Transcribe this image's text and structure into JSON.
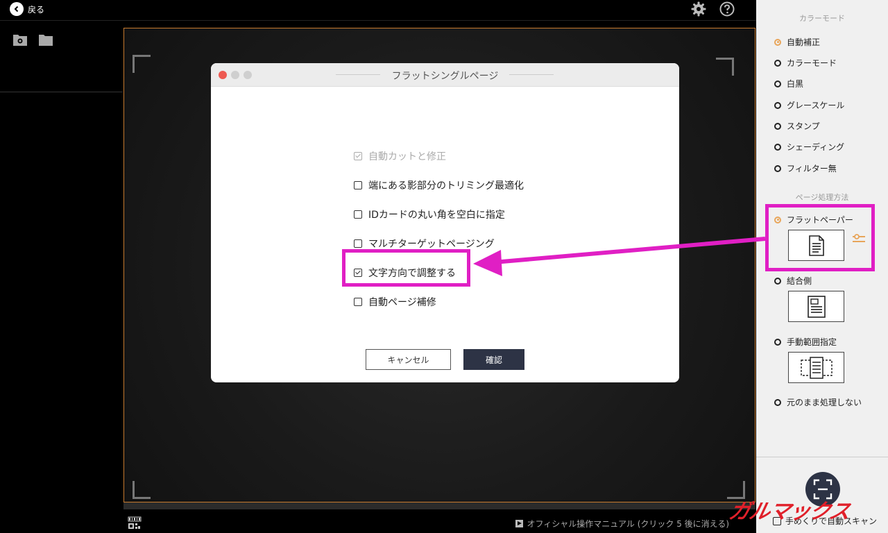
{
  "topbar": {
    "back_label": "戻る"
  },
  "dialog": {
    "title": "フラットシングルページ",
    "options": [
      {
        "label": "自動カットと修正",
        "checked": true,
        "disabled": true
      },
      {
        "label": "端にある影部分のトリミング最適化",
        "checked": false,
        "disabled": false
      },
      {
        "label": "IDカードの丸い角を空白に指定",
        "checked": false,
        "disabled": false
      },
      {
        "label": "マルチターゲットページング",
        "checked": false,
        "disabled": false
      },
      {
        "label": "文字方向で調整する",
        "checked": true,
        "disabled": false
      },
      {
        "label": "自動ページ補修",
        "checked": false,
        "disabled": false
      }
    ],
    "cancel_label": "キャンセル",
    "confirm_label": "確認"
  },
  "right_panel": {
    "color_mode_title": "カラーモード",
    "color_modes": [
      {
        "label": "自動補正",
        "selected": true
      },
      {
        "label": "カラーモード",
        "selected": false
      },
      {
        "label": "白黒",
        "selected": false
      },
      {
        "label": "グレースケール",
        "selected": false
      },
      {
        "label": "スタンプ",
        "selected": false
      },
      {
        "label": "シェーディング",
        "selected": false
      },
      {
        "label": "フィルター無",
        "selected": false
      }
    ],
    "page_processing_title": "ページ処理方法",
    "page_modes": [
      {
        "label": "フラットペーパー",
        "selected": true,
        "icon": "flat-page-icon"
      },
      {
        "label": "結合側",
        "selected": false,
        "icon": "book-spread-icon"
      },
      {
        "label": "手動範囲指定",
        "selected": false,
        "icon": "manual-range-icon"
      },
      {
        "label": "元のまま処理しない",
        "selected": false
      }
    ],
    "auto_scan_label": "手めくりで自動スキャン"
  },
  "bottom_bar": {
    "manual_link": "オフィシャル操作マニュアル (クリック 5 後に消える)"
  },
  "watermark": "ガルマックス",
  "colors": {
    "accent_orange": "#e8a55a",
    "highlight_magenta": "#e01fc4",
    "primary_button": "#2d3345",
    "watermark_red": "#e0202a"
  }
}
